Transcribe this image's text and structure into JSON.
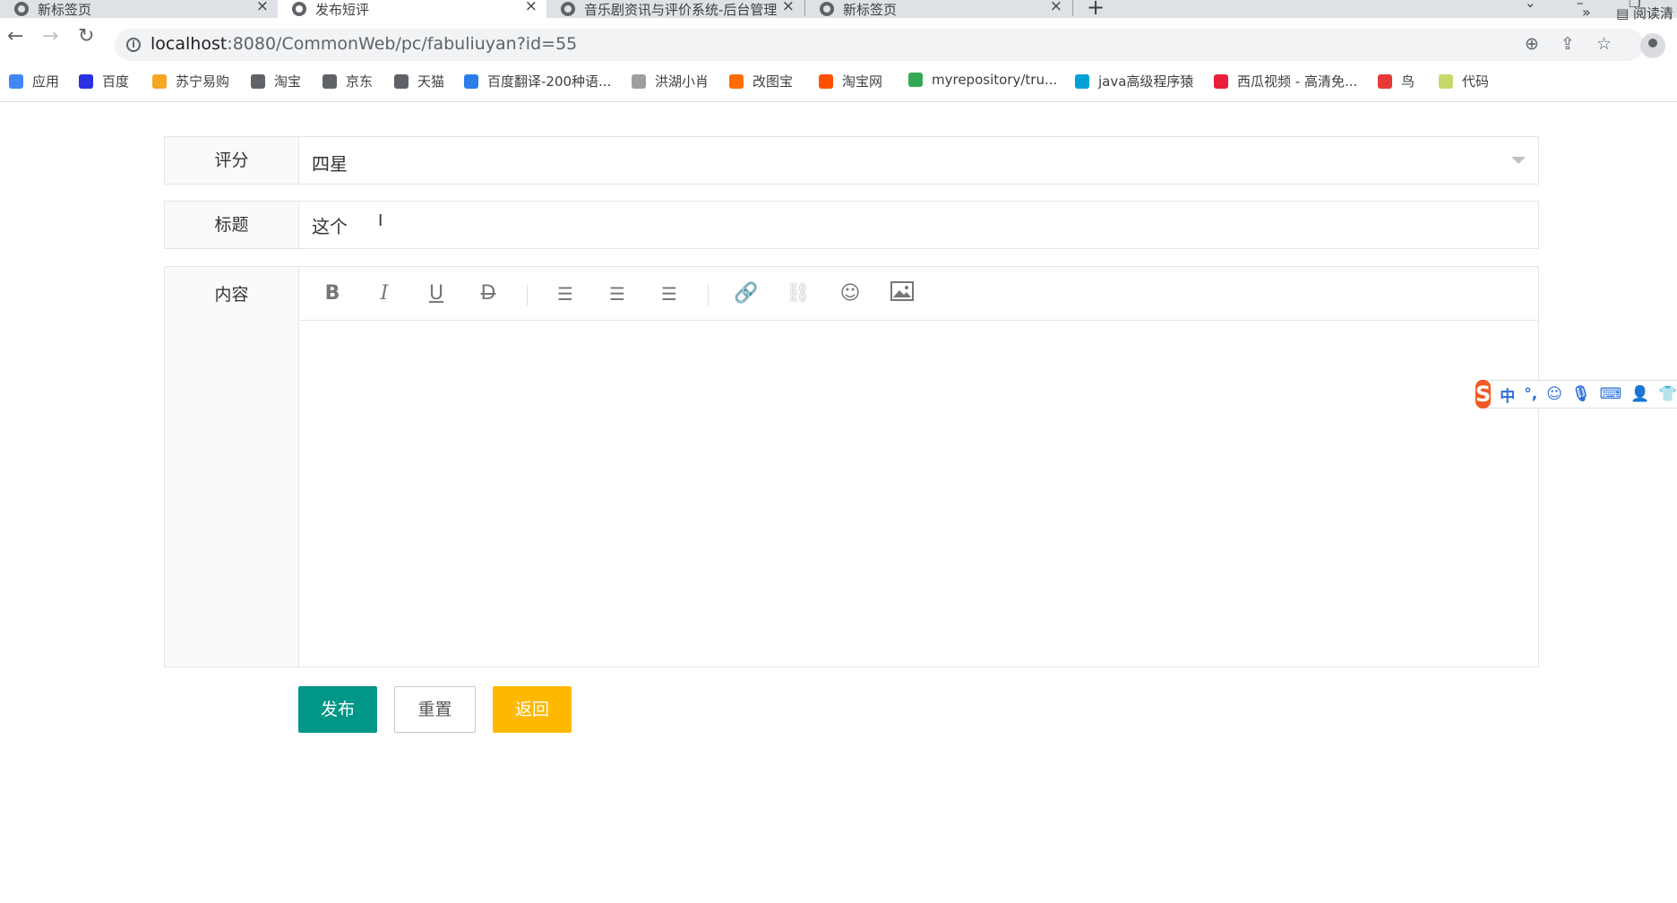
{
  "browser": {
    "tabs": [
      {
        "title": "新标签页",
        "active": false
      },
      {
        "title": "发布短评",
        "active": true
      },
      {
        "title": "音乐剧资讯与评价系统-后台管理",
        "active": false
      },
      {
        "title": "新标签页",
        "active": false
      }
    ],
    "url_host": "localhost",
    "url_rest": ":8080/CommonWeb/pc/fabuliuyan?id=55",
    "bookmarks": [
      {
        "label": "应用",
        "color": "#4285f4"
      },
      {
        "label": "百度",
        "color": "#2932e1"
      },
      {
        "label": "苏宁易购",
        "color": "#f5a623"
      },
      {
        "label": "淘宝",
        "color": "#5f6368"
      },
      {
        "label": "京东",
        "color": "#5f6368"
      },
      {
        "label": "天猫",
        "color": "#5f6368"
      },
      {
        "label": "百度翻译-200种语...",
        "color": "#2b7de9"
      },
      {
        "label": "洪湖小肖",
        "color": "#9e9e9e"
      },
      {
        "label": "改图宝",
        "color": "#ff6d00"
      },
      {
        "label": "淘宝网",
        "color": "#ff5000"
      },
      {
        "label": "myrepository/tru...",
        "color": "#34a853"
      },
      {
        "label": "java高级程序猿",
        "color": "#00a1d6"
      },
      {
        "label": "西瓜视频 - 高清免...",
        "color": "#ea1f3c"
      },
      {
        "label": "鸟",
        "color": "#e53935"
      },
      {
        "label": "代码",
        "color": "#c6d86a"
      }
    ],
    "bookmarks_more": "»",
    "reading_list": "阅读清"
  },
  "form": {
    "score": {
      "label": "评分",
      "value": "四星"
    },
    "title": {
      "label": "标题",
      "value": "这个"
    },
    "content": {
      "label": "内容"
    },
    "editor_tools": [
      "bold-icon",
      "italic-icon",
      "underline-icon",
      "strikethrough-icon",
      "align-left-icon",
      "align-center-icon",
      "align-right-icon",
      "link-icon",
      "unlink-icon",
      "emoji-icon",
      "image-icon"
    ],
    "buttons": {
      "submit": "发布",
      "reset": "重置",
      "back": "返回"
    },
    "colors": {
      "submit": "#009688",
      "back": "#ffb800"
    }
  },
  "ime": {
    "logo": "S",
    "mode": "中",
    "punct": "°,"
  }
}
